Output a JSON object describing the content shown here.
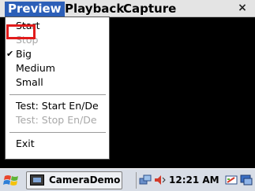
{
  "menubar": {
    "preview": "Preview",
    "playback": "Playback",
    "capture": "Capture",
    "close": "×"
  },
  "preview_menu": {
    "items": [
      {
        "label": "Start",
        "enabled": true
      },
      {
        "label": "Stop",
        "enabled": false
      },
      {
        "label": "Big",
        "enabled": true,
        "checked": true
      },
      {
        "label": "Medium",
        "enabled": true
      },
      {
        "label": "Small",
        "enabled": true
      },
      {
        "label": "Test: Start En/De",
        "enabled": true
      },
      {
        "label": "Test: Stop En/De",
        "enabled": false
      },
      {
        "label": "Exit",
        "enabled": true
      }
    ],
    "check_glyph": "✔"
  },
  "taskbar": {
    "app_label": "CameraDemo",
    "clock": "12:21 AM"
  },
  "colors": {
    "menu_active": "#2c5fb8",
    "highlight": "#e11b1b",
    "video_bg": "#000000",
    "disabled_text": "#a8a8a8"
  }
}
